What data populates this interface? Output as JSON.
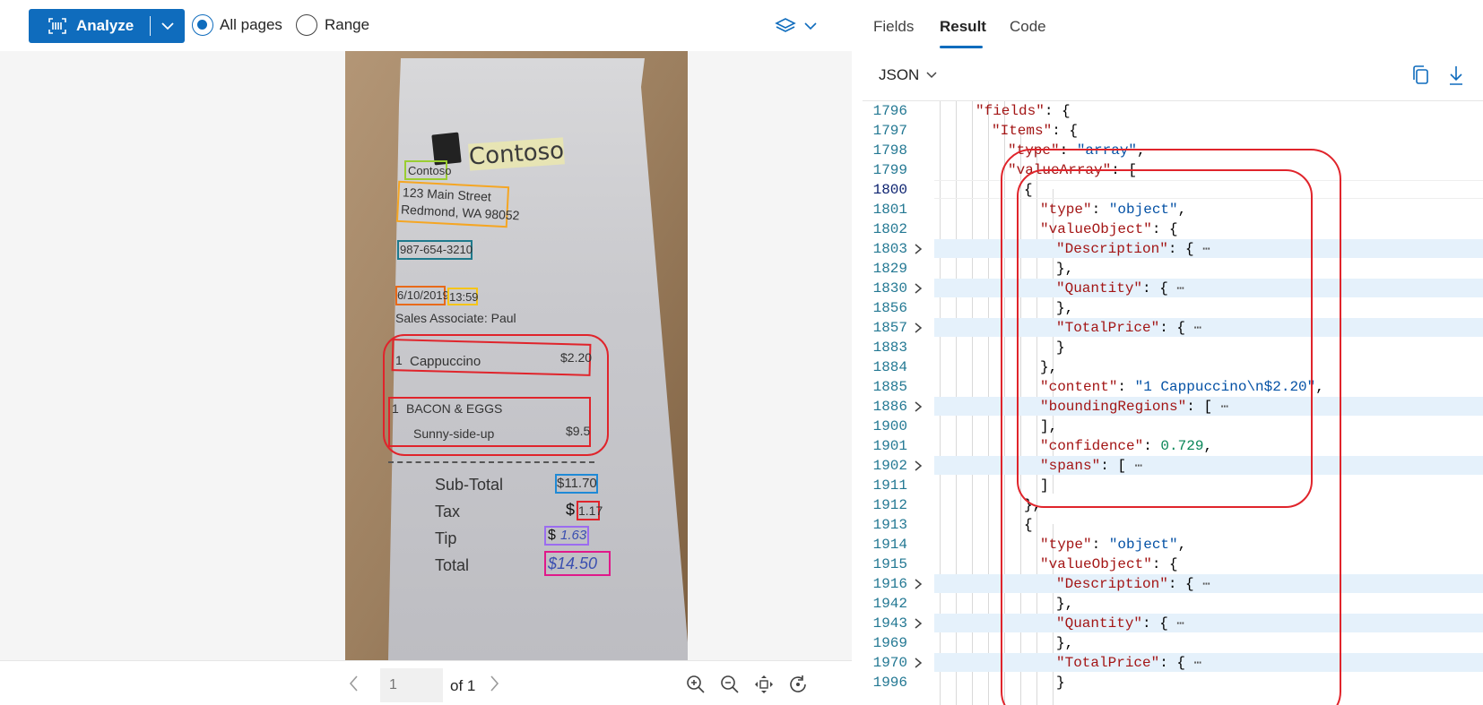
{
  "toolbar": {
    "analyze_label": "Analyze",
    "radio_all": "All pages",
    "radio_range": "Range",
    "selected": "All pages"
  },
  "pager": {
    "page_placeholder": "1",
    "of_label": "of 1"
  },
  "receipt": {
    "brand": "Contoso",
    "name": "Contoso",
    "address_line1": "123 Main Street",
    "address_line2": "Redmond, WA 98052",
    "phone": "987-654-3210",
    "date": "6/10/2019",
    "time": "13:59",
    "associate": "Sales Associate: Paul",
    "item1_qty": "1",
    "item1_name": "Cappuccino",
    "item1_price": "$2.20",
    "item2_qty": "1",
    "item2_name": "BACON & EGGS",
    "item2_sub": "Sunny-side-up",
    "item2_price": "$9.5",
    "subtotal_label": "Sub-Total",
    "subtotal_value": "$11.70",
    "tax_label": "Tax",
    "tax_currency": "$",
    "tax_value": "1.17",
    "tip_label": "Tip",
    "tip_currency": "$",
    "tip_value": "1.63",
    "total_label": "Total",
    "total_value": "$14.50"
  },
  "right": {
    "tabs": [
      "Fields",
      "Result",
      "Code"
    ],
    "active_tab": "Result",
    "format": "JSON"
  },
  "colors": {
    "accent": "#0f6cbd",
    "highlight_red": "#e0242b",
    "fold_bg": "#e5f1fb"
  },
  "code_lines": [
    {
      "n": "1796"
    },
    {
      "n": "1797"
    },
    {
      "n": "1798"
    },
    {
      "n": "1799"
    },
    {
      "n": "1800"
    },
    {
      "n": "1801"
    },
    {
      "n": "1802"
    },
    {
      "n": "1803"
    },
    {
      "n": "1829"
    },
    {
      "n": "1830"
    },
    {
      "n": "1856"
    },
    {
      "n": "1857"
    },
    {
      "n": "1883"
    },
    {
      "n": "1884"
    },
    {
      "n": "1885"
    },
    {
      "n": "1886"
    },
    {
      "n": "1900"
    },
    {
      "n": "1901"
    },
    {
      "n": "1902"
    },
    {
      "n": "1911"
    },
    {
      "n": "1912"
    },
    {
      "n": "1913"
    },
    {
      "n": "1914"
    },
    {
      "n": "1915"
    },
    {
      "n": "1916"
    },
    {
      "n": "1942"
    },
    {
      "n": "1943"
    },
    {
      "n": "1969"
    },
    {
      "n": "1970"
    },
    {
      "n": "1996"
    }
  ],
  "code": {
    "fields_key": "\"fields\"",
    "items_key": "\"Items\"",
    "type_key": "\"type\"",
    "array_val": "\"array\"",
    "valuearray_key": "\"valueArray\"",
    "object_val": "\"object\"",
    "valueobject_key": "\"valueObject\"",
    "description_key": "\"Description\"",
    "quantity_key": "\"Quantity\"",
    "totalprice_key": "\"TotalPrice\"",
    "content_key": "\"content\"",
    "content_val": "\"1 Cappuccino\\n$2.20\"",
    "boundingregions_key": "\"boundingRegions\"",
    "confidence_key": "\"confidence\"",
    "confidence_val": "0.729",
    "spans_key": "\"spans\"",
    "ellipsis": "⋯"
  }
}
